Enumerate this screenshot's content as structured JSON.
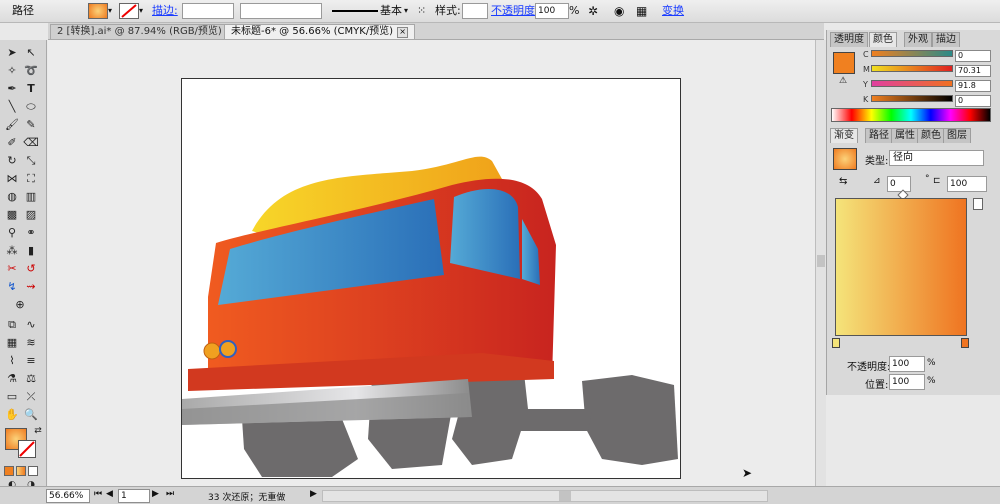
{
  "control_bar": {
    "object_type": "路径",
    "stroke_label": "描边:",
    "stroke_profile": "基本",
    "style_label": "样式:",
    "opacity_label": "不透明度:",
    "opacity_value": "100",
    "opacity_unit": "%",
    "transform_link": "变换"
  },
  "tabs": [
    {
      "label": "2 [转换].ai* @ 87.94% (RGB/预览)",
      "close": "×"
    },
    {
      "label": "未标题-6* @ 56.66% (CMYK/预览)",
      "close": "×"
    }
  ],
  "panels": {
    "top_tabs": [
      "透明度",
      "颜色",
      "外观",
      "描边"
    ],
    "cmyk": [
      {
        "label": "C",
        "value": "0"
      },
      {
        "label": "M",
        "value": "70.31"
      },
      {
        "label": "Y",
        "value": "91.8"
      },
      {
        "label": "K",
        "value": "0"
      }
    ],
    "gradient_tabs": [
      "渐变",
      "路径",
      "属性",
      "颜色",
      "图层"
    ],
    "type_label": "类型:",
    "type_value": "径向",
    "angle_value": "0",
    "angle_unit": "°",
    "aspect_value": "100",
    "opacity_label": "不透明度:",
    "opacity_value": "100",
    "location_label": "位置:",
    "location_value": "100",
    "percent": "%"
  },
  "status": {
    "zoom": "56.66%",
    "artboard": "1",
    "undo_info": "33 次还原；无重做"
  },
  "colors": {
    "fill": "#f08020",
    "gradient_start": "#f4e47a",
    "gradient_end": "#ef7421",
    "truck_red": "#d4301e",
    "window_blue": "#3a7fc4",
    "roof_yellow": "#f3b419",
    "wheel_gray": "#6d6b6c"
  }
}
